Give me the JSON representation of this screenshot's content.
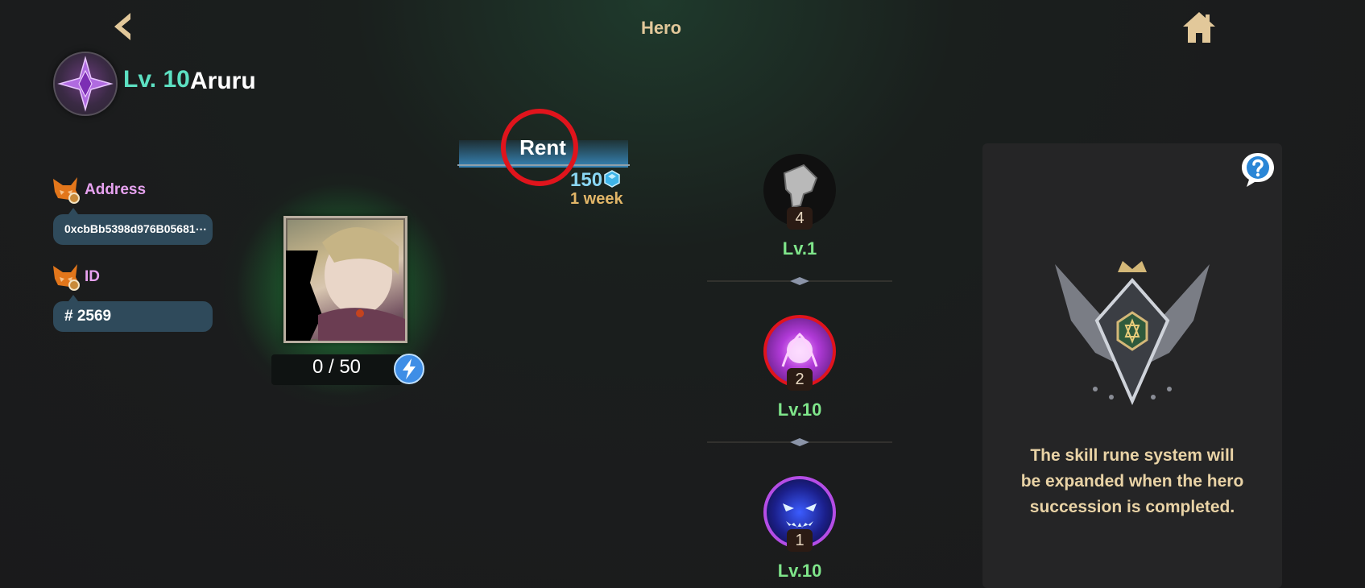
{
  "header": {
    "title": "Hero",
    "back_icon": "chevron-left-icon",
    "home_icon": "home-icon"
  },
  "hero": {
    "level_label": "Lv. 10",
    "name": "Aruru",
    "class_icon": "purple-star-emblem-icon"
  },
  "address": {
    "label": "Address",
    "value": "0xcbBb5398d976B05681⋯"
  },
  "id_field": {
    "label": "ID",
    "value": "# 2569"
  },
  "experience": {
    "text": "0 / 50",
    "button_icon": "lightning-icon"
  },
  "rent": {
    "label": "Rent",
    "price": "150",
    "currency_icon": "blue-gem-icon",
    "duration": "1 week"
  },
  "skills": [
    {
      "icon": "gauntlet-icon",
      "count": "4",
      "level": "Lv.1"
    },
    {
      "icon": "purple-flame-orb-icon",
      "count": "2",
      "level": "Lv.10"
    },
    {
      "icon": "demon-face-icon",
      "count": "1",
      "level": "Lv.10"
    }
  ],
  "info_panel": {
    "help_icon": "question-icon",
    "crest_icon": "winged-crest-icon",
    "message_line1": "The skill rune system will",
    "message_line2": "be expanded when the hero",
    "message_line3": "succession is completed."
  },
  "colors": {
    "accent_gold": "#e2c89a",
    "level_teal": "#5de0c2",
    "skill_level_green": "#7fe58a",
    "highlight_red": "#e0141c"
  }
}
